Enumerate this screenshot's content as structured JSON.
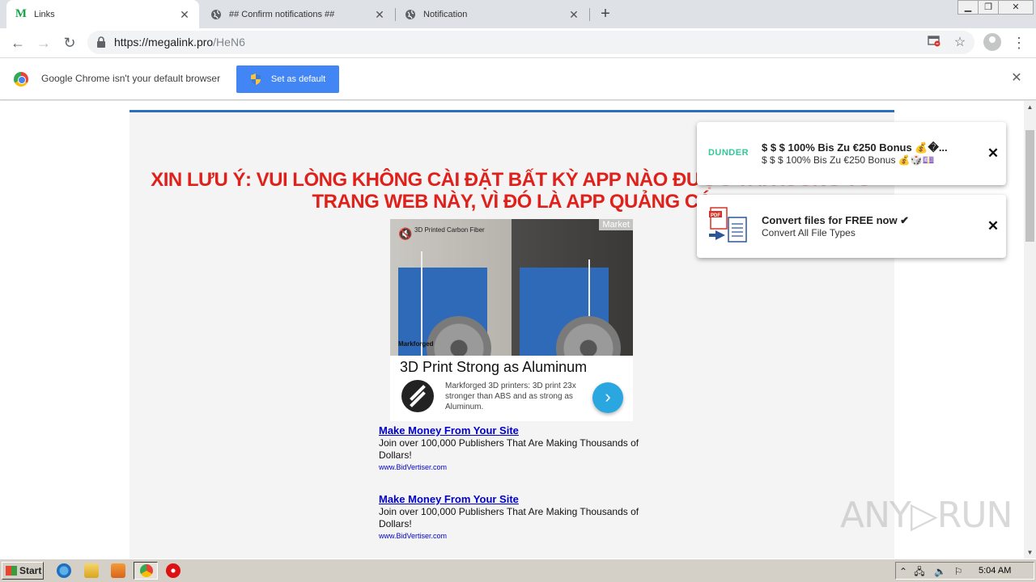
{
  "browser": {
    "tabs": [
      {
        "title": "Links",
        "active": true,
        "favicon": "letter-m-icon"
      },
      {
        "title": "## Confirm notifications ##",
        "active": false,
        "favicon": "globe-icon"
      },
      {
        "title": "Notification",
        "active": false,
        "favicon": "globe-icon"
      }
    ],
    "tab_close": "✕",
    "new_tab": "+",
    "url_host": "https://megalink.pro",
    "url_path": "/HeN6"
  },
  "infobar": {
    "message": "Google Chrome isn't your default browser",
    "button": "Set as default"
  },
  "page": {
    "warning_line1": "XIN LƯU Ý: VUI LÒNG KHÔNG CÀI ĐẶT BẤT KỲ APP NÀO ĐƯ",
    "warning_line1_faded": "ỢC TẢI XUỐNG TỪ",
    "warning_line2": "TRANG WEB NÀY, VÌ ĐÓ LÀ APP QUẢNG CÁ",
    "ad": {
      "image_caption": "3D Printed Carbon Fiber",
      "image_brand": "Markforged",
      "market_label": "Market",
      "headline": "3D Print Strong as Aluminum",
      "description": "Markforged 3D printers: 3D print 23x stronger than ABS and as strong as Aluminum."
    },
    "text_ads": [
      {
        "title": "Make Money From Your Site",
        "body": "Join over 100,000 Publishers That Are Making Thousands of Dollars!",
        "url": "www.BidVertiser.com"
      },
      {
        "title": "Make Money From Your Site",
        "body": "Join over 100,000 Publishers That Are Making Thousands of Dollars!",
        "url": "www.BidVertiser.com"
      }
    ]
  },
  "notifications": [
    {
      "icon": "dunder-logo",
      "icon_text": "DUNDER",
      "title": "$ $ $ 100% Bis Zu €250 Bonus 💰�...",
      "body": "$ $ $ 100% Bis Zu €250 Bonus 💰🎲💷"
    },
    {
      "icon": "pdf-convert-icon",
      "title": "Convert files for FREE now ✔",
      "body": "Convert All File Types"
    }
  ],
  "watermark": "ANY▷RUN",
  "taskbar": {
    "start_label": "Start",
    "clock": "5:04 AM"
  },
  "colors": {
    "warning_red": "#e0201b",
    "accent_blue": "#4285f4",
    "container_border": "#2d6fbd",
    "link_blue": "#0000cc",
    "dunder_green": "#34c99a"
  }
}
